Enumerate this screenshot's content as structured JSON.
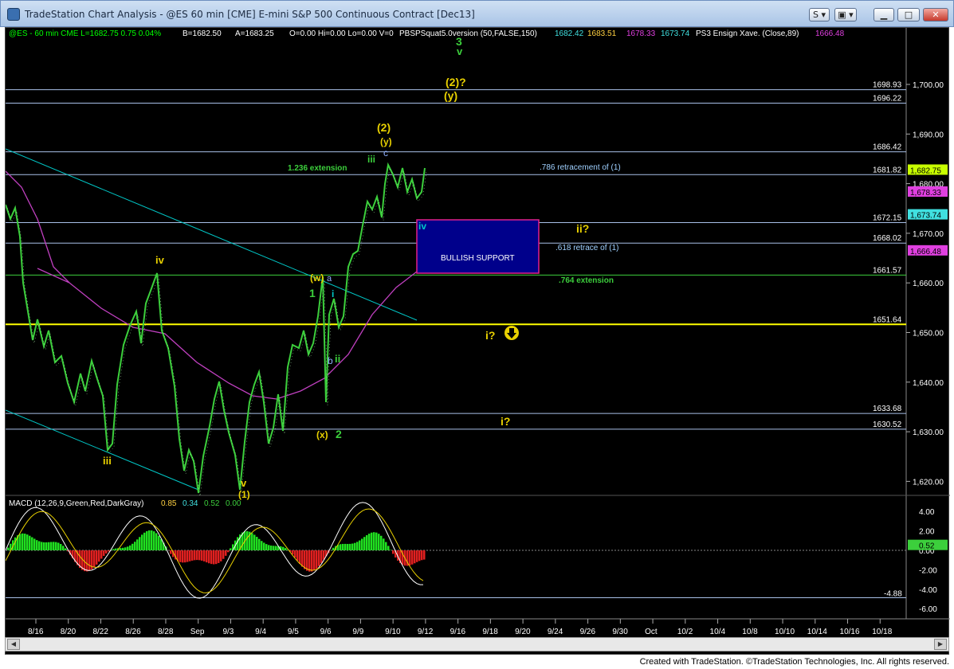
{
  "window": {
    "title": "TradeStation Chart Analysis - @ES 60 min [CME] E-mini S&P 500 Continuous Contract [Dec13]",
    "buttons": {
      "s_label": "S",
      "box_label": "▣"
    }
  },
  "header": {
    "symbol_line": "@ES - 60 min  CME  L=1682.75  0.75  0.04%",
    "bid": "B=1682.50",
    "ask": "A=1683.25",
    "ohlv": "O=0.00  Hi=0.00  Lo=0.00  V=0",
    "indicator": "PBSPSquat5.0version (50,FALSE,150)",
    "v1": "1682.42",
    "v2": "1683.51",
    "v3": "1678.33",
    "v4": "1673.74",
    "indicator2": "PS3 Ensign Xave. (Close,89)",
    "v5": "1666.48"
  },
  "colors": {
    "cyan": "#00c8c8",
    "yellow": "#ffff00",
    "green": "#3ccf3c",
    "magenta": "#c040c0",
    "wave_yellow": "#d8c800"
  },
  "price_axis": {
    "labels": [
      "1,700.00",
      "1,690.00",
      "1,680.00",
      "1,670.00",
      "1,660.00",
      "1,650.00",
      "1,640.00",
      "1,630.00",
      "1,620.00"
    ],
    "values": [
      1700,
      1690,
      1680,
      1670,
      1660,
      1650,
      1640,
      1630,
      1620
    ]
  },
  "levels": [
    {
      "label": "1698.93",
      "value": 1698.93
    },
    {
      "label": "1696.22",
      "value": 1696.22
    },
    {
      "label": "1686.42",
      "value": 1686.42
    },
    {
      "label": "1681.82",
      "value": 1681.82
    },
    {
      "label": "1672.15",
      "value": 1672.15
    },
    {
      "label": "1668.02",
      "value": 1668.02
    },
    {
      "label": "1661.57",
      "value": 1661.57
    },
    {
      "label": "1651.64",
      "value": 1651.64
    },
    {
      "label": "1633.68",
      "value": 1633.68
    },
    {
      "label": "1630.52",
      "value": 1630.52
    }
  ],
  "price_tags": [
    {
      "label": "1,682.75",
      "value": 1682.75,
      "color": "#c8ff00"
    },
    {
      "label": "1,678.33",
      "value": 1678.33,
      "color": "#e040e0"
    },
    {
      "label": "1,673.74",
      "value": 1673.74,
      "color": "#40e0e0"
    },
    {
      "label": "1,666.48",
      "value": 1666.48,
      "color": "#e040e0"
    }
  ],
  "annotations": {
    "ext_1236": "1.236 extension",
    "retr_786": ".786 retracement of (1)",
    "retr_618": ".618 retrace of (1)",
    "ext_764": ".764 extension",
    "bullish_support": "BULLISH SUPPORT",
    "w3": "3",
    "wv_top": "v",
    "w2q": "(2)?",
    "wy_top": "(y)",
    "w2": "(2)",
    "wy": "(y)",
    "wc": "c",
    "wiii": "iii",
    "wiv_blue": "iv",
    "wii_q": "ii?",
    "wiv_left": "iv",
    "ww": "(w)",
    "wa": "a",
    "w1": "1",
    "wi": "i",
    "wi_q": "i?",
    "wb": "b",
    "wii": "ii",
    "wx": "(x)",
    "w2g": "2",
    "wi_q2": "i?",
    "wiii_low": "iii",
    "wv": "v",
    "w1p": "(1)"
  },
  "macd": {
    "label": "MACD (12,26,9,Green,Red,DarkGray)",
    "v1": "0.85",
    "v2": "0.34",
    "v3": "0.52",
    "v4": "0.00",
    "axis_labels": [
      "4.00",
      "2.00",
      "0.00",
      "-2.00",
      "-4.00",
      "-6.00"
    ],
    "axis_values": [
      4,
      2,
      0,
      -2,
      -4,
      -6
    ],
    "level_label": "-4.88",
    "current_tag": "0.52"
  },
  "time_axis": [
    "8/16",
    "8/20",
    "8/22",
    "8/26",
    "8/28",
    "Sep",
    "9/3",
    "9/4",
    "9/5",
    "9/6",
    "9/9",
    "9/10",
    "9/12",
    "9/16",
    "9/18",
    "9/20",
    "9/24",
    "9/26",
    "9/30",
    "Oct",
    "10/2",
    "10/4",
    "10/8",
    "10/10",
    "10/14",
    "10/16",
    "10/18"
  ],
  "status": {
    "credits": "Created with TradeStation. ©TradeStation Technologies, Inc. All rights reserved."
  }
}
